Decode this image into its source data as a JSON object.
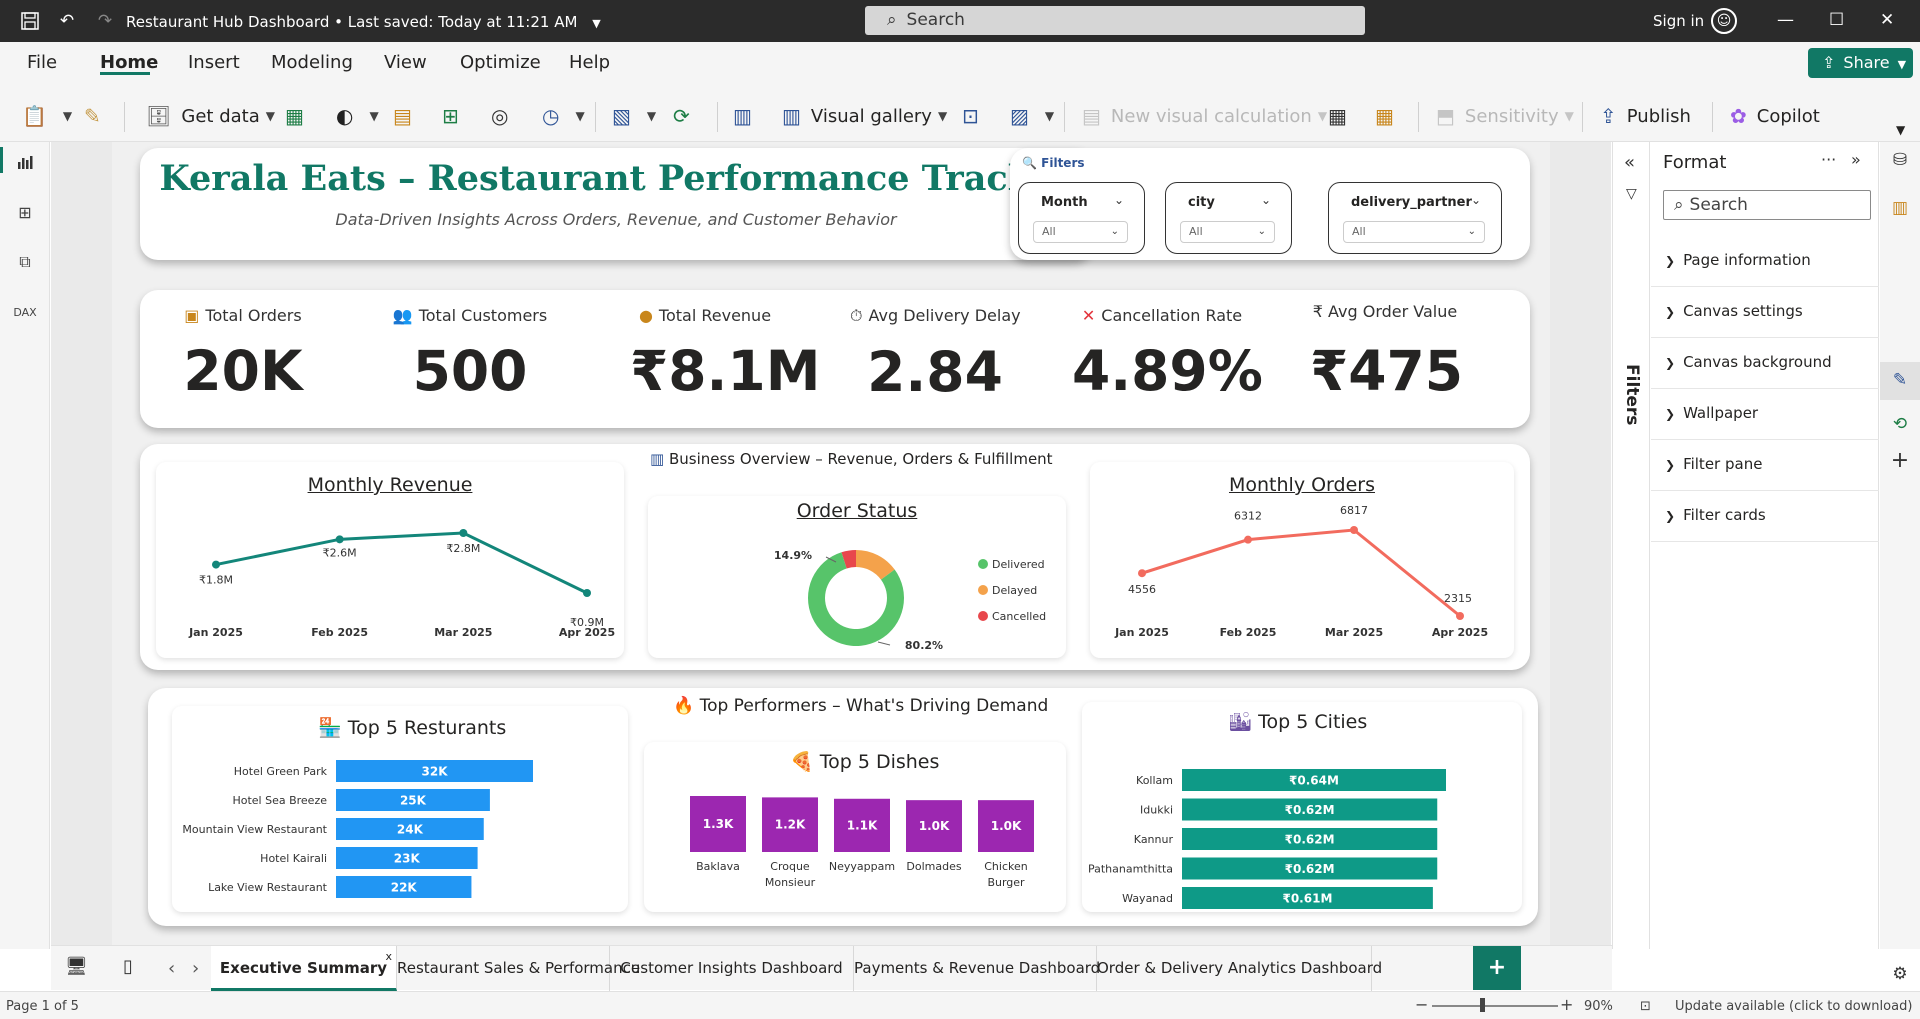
{
  "titlebar": {
    "title": "Restaurant Hub Dashboard",
    "saved": "Last saved: Today at 11:21 AM",
    "search_label": "Search",
    "sign_in": "Sign in"
  },
  "menu": {
    "file": "File",
    "home": "Home",
    "insert": "Insert",
    "modeling": "Modeling",
    "view": "View",
    "optimize": "Optimize",
    "help": "Help",
    "share": "Share"
  },
  "toolbar": {
    "get_data": "Get data",
    "visual_gallery": "Visual gallery",
    "new_visual_calc": "New visual calculation",
    "sensitivity": "Sensitivity",
    "publish": "Publish",
    "copilot": "Copilot"
  },
  "header": {
    "title": "Kerala Eats – Restaurant Performance Tracker",
    "subtitle": "Data-Driven Insights Across Orders, Revenue, and Customer Behavior"
  },
  "filters": {
    "label": "Filters",
    "slicers": [
      {
        "name": "Month",
        "value": "All"
      },
      {
        "name": "city",
        "value": "All"
      },
      {
        "name": "delivery_partner",
        "value": "All"
      }
    ]
  },
  "kpis": [
    {
      "label": "Total Orders",
      "value": "20K",
      "icon": "box-icon"
    },
    {
      "label": "Total Customers",
      "value": "500",
      "icon": "people-icon"
    },
    {
      "label": "Total Revenue",
      "value": "₹8.1M",
      "icon": "money-bag-icon"
    },
    {
      "label": "Avg Delivery Delay",
      "value": "2.84",
      "icon": "stopwatch-icon"
    },
    {
      "label": "Cancellation Rate",
      "value": "4.89%",
      "icon": "cross-icon"
    },
    {
      "label": "₹ Avg Order Value",
      "value": "₹475",
      "icon": "rupee-icon"
    }
  ],
  "overview": {
    "section_title": "Business Overview – Revenue, Orders & Fulfillment",
    "monthly_revenue_title": "Monthly Revenue",
    "order_status_title": "Order Status",
    "monthly_orders_title": "Monthly Orders"
  },
  "performers": {
    "section_title": "Top Performers – What's Driving Demand",
    "restaurants_title": "Top 5 Resturants",
    "dishes_title": "Top 5 Dishes",
    "cities_title": "Top 5 Cities"
  },
  "chart_data": [
    {
      "type": "line",
      "title": "Monthly Revenue",
      "categories": [
        "Jan 2025",
        "Feb 2025",
        "Mar 2025",
        "Apr 2025"
      ],
      "values": [
        1.8,
        2.6,
        2.8,
        0.9
      ],
      "data_labels": [
        "₹1.8M",
        "₹2.6M",
        "₹2.8M",
        "₹0.9M"
      ],
      "color": "#13867a"
    },
    {
      "type": "pie",
      "title": "Order Status",
      "categories": [
        "Delivered",
        "Delayed",
        "Cancelled"
      ],
      "values": [
        80.2,
        14.9,
        4.9
      ],
      "data_labels": [
        "80.2%",
        "14.9%"
      ],
      "colors": [
        "#57c46a",
        "#f4a24b",
        "#e8474c"
      ],
      "legend": "right"
    },
    {
      "type": "line",
      "title": "Monthly Orders",
      "categories": [
        "Jan 2025",
        "Feb 2025",
        "Mar 2025",
        "Apr 2025"
      ],
      "values": [
        4556,
        6312,
        6817,
        2315
      ],
      "data_labels": [
        "4556",
        "6312",
        "6817",
        "2315"
      ],
      "color": "#f26b5e"
    },
    {
      "type": "bar",
      "title": "Top 5 Resturants",
      "orientation": "horizontal",
      "categories": [
        "Hotel Green Park",
        "Hotel Sea Breeze",
        "Mountain View Restaurant",
        "Hotel Kairali",
        "Lake View Restaurant"
      ],
      "values": [
        32000,
        25000,
        24000,
        23000,
        22000
      ],
      "data_labels": [
        "32K",
        "25K",
        "24K",
        "23K",
        "22K"
      ],
      "color": "#2196f3"
    },
    {
      "type": "bar",
      "title": "Top 5 Dishes",
      "orientation": "vertical",
      "categories": [
        "Baklava",
        "Croque Monsieur",
        "Neyyappam",
        "Dolmades",
        "Chicken Burger"
      ],
      "values": [
        1300,
        1200,
        1100,
        1000,
        1000
      ],
      "data_labels": [
        "1.3K",
        "1.2K",
        "1.1K",
        "1.0K",
        "1.0K"
      ],
      "color": "#9c27b0"
    },
    {
      "type": "bar",
      "title": "Top 5 Cities",
      "orientation": "horizontal",
      "categories": [
        "Kollam",
        "Idukki",
        "Kannur",
        "Pathanamthitta",
        "Wayanad"
      ],
      "values": [
        0.64,
        0.62,
        0.62,
        0.62,
        0.61
      ],
      "data_labels": [
        "₹0.64M",
        "₹0.62M",
        "₹0.62M",
        "₹0.62M",
        "₹0.61M"
      ],
      "color": "#0e9a87"
    }
  ],
  "filter_pane": {
    "label": "Filters"
  },
  "format_pane": {
    "title": "Format",
    "search_placeholder": "Search",
    "sections": [
      "Page information",
      "Canvas settings",
      "Canvas background",
      "Wallpaper",
      "Filter pane",
      "Filter cards"
    ]
  },
  "tabs": [
    "Executive Summary",
    "Restaurant Sales & Performance",
    "Customer Insights Dashboard",
    "Payments & Revenue Dashboard",
    "Order & Delivery Analytics Dashboard"
  ],
  "status": {
    "page": "Page 1 of 5",
    "zoom": "90%",
    "update": "Update available (click to download)"
  }
}
